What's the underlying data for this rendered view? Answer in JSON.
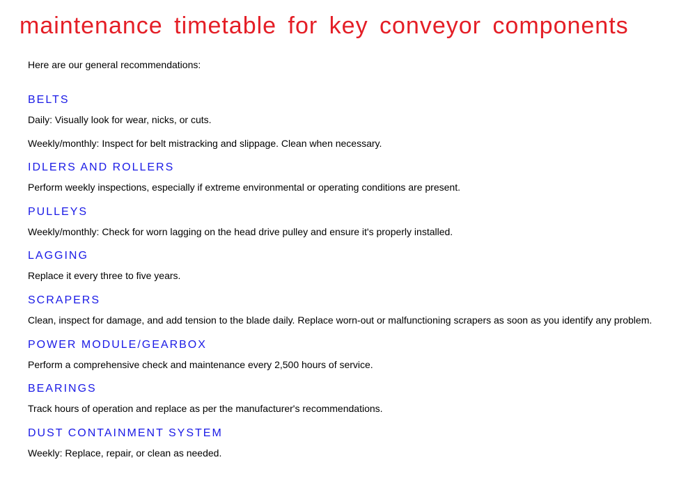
{
  "title": "maintenance timetable for key conveyor components",
  "intro": "Here are our general recommendations:",
  "sections": [
    {
      "heading": "BELTS",
      "paragraphs": [
        "Daily: Visually look for wear, nicks, or cuts.",
        "Weekly/monthly: Inspect for belt mistracking and slippage. Clean when necessary."
      ]
    },
    {
      "heading": "IDLERS AND ROLLERS",
      "paragraphs": [
        "Perform weekly inspections, especially if extreme environmental or operating conditions are present."
      ]
    },
    {
      "heading": "PULLEYS",
      "paragraphs": [
        "Weekly/monthly: Check for worn lagging on the head drive pulley and ensure it's properly installed."
      ]
    },
    {
      "heading": "LAGGING",
      "paragraphs": [
        "Replace it every three to five years."
      ]
    },
    {
      "heading": "SCRAPERS",
      "paragraphs": [
        "Clean, inspect for damage, and add tension to the blade daily. Replace worn-out or malfunctioning scrapers as soon as you identify any problem."
      ]
    },
    {
      "heading": "POWER MODULE/GEARBOX",
      "paragraphs": [
        "Perform a comprehensive check and maintenance every 2,500 hours of service."
      ]
    },
    {
      "heading": "BEARINGS",
      "paragraphs": [
        "Track hours of operation and replace as per the manufacturer's recommendations."
      ]
    },
    {
      "heading": "DUST CONTAINMENT SYSTEM",
      "paragraphs": [
        "Weekly: Replace, repair, or clean as needed."
      ]
    }
  ]
}
